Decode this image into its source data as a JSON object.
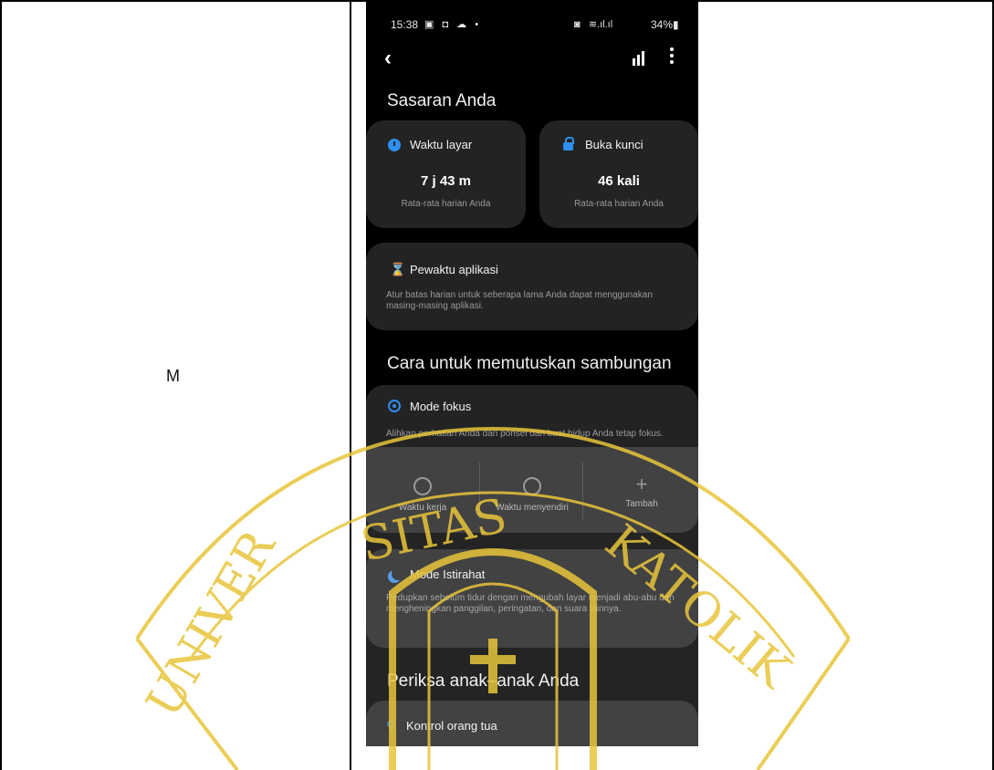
{
  "document": {
    "cell_label": "M"
  },
  "status_bar": {
    "time": "15:38",
    "battery": "34%"
  },
  "appbar": {
    "back_icon": "chevron-left-icon",
    "stats_icon": "bar-chart-icon",
    "more_icon": "more-vertical-icon"
  },
  "goals": {
    "section_title": "Sasaran Anda",
    "screen_time": {
      "title": "Waktu layar",
      "value": "7 j 43 m",
      "caption": "Rata-rata harian Anda",
      "icon": "clock-icon"
    },
    "unlocks": {
      "title": "Buka kunci",
      "value": "46 kali",
      "caption": "Rata-rata harian Anda",
      "icon": "unlock-icon"
    }
  },
  "app_timer": {
    "title": "Pewaktu aplikasi",
    "description": "Atur batas harian untuk seberapa lama Anda dapat menggunakan masing-masing aplikasi.",
    "icon": "hourglass-icon"
  },
  "disconnect": {
    "section_title": "Cara untuk memutuskan sambungan",
    "focus_mode": {
      "title": "Mode fokus",
      "description": "Alihkan perhatian Anda dari ponsel dan buat hidup Anda tetap fokus.",
      "icon": "focus-target-icon",
      "modes": [
        {
          "label": "Waktu kerja"
        },
        {
          "label": "Waktu menyendiri"
        },
        {
          "label": "Tambah"
        }
      ]
    },
    "wind_down": {
      "title": "Mode Istirahat",
      "description": "Redupkan sebelum tidur dengan mengubah layar menjadi abu-abu dan mengheningkan panggilan, peringatan, dan suara lainnya.",
      "icon": "moon-icon"
    }
  },
  "children": {
    "section_title": "Periksa anak–anak Anda",
    "parental_control": {
      "title": "Kontrol orang tua",
      "icon": "parent-child-icon"
    }
  },
  "watermark": {
    "text_left": "UNIVER",
    "text_top": "SITAS",
    "text_right": "KATOLIK",
    "color": "#e8c53a"
  }
}
